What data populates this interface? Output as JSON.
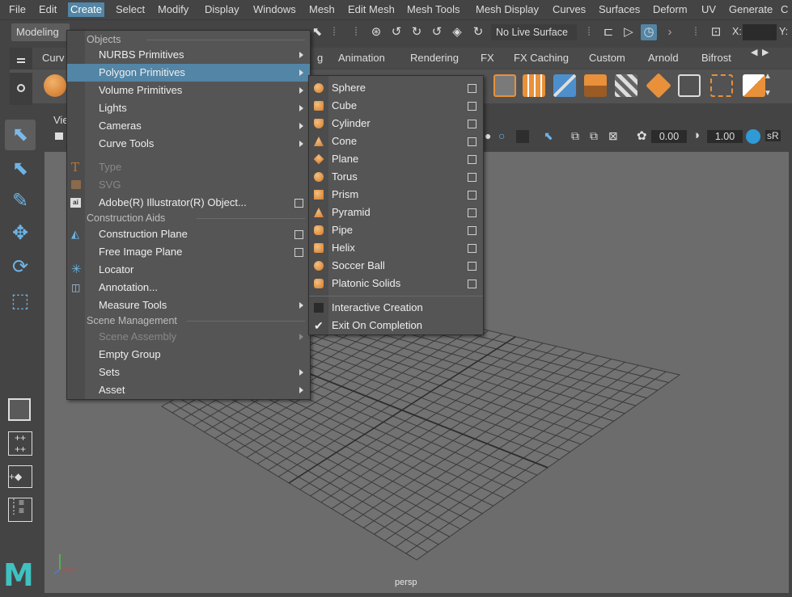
{
  "menubar": {
    "items": [
      "File",
      "Edit",
      "Create",
      "Select",
      "Modify",
      "Display",
      "Windows",
      "Mesh",
      "Edit Mesh",
      "Mesh Tools",
      "Mesh Display",
      "Curves",
      "Surfaces",
      "Deform",
      "UV",
      "Generate",
      "C"
    ]
  },
  "status_line": {
    "mode": "Modeling",
    "live_surface": "No Live Surface",
    "x_label": "X:",
    "y_label": "Y:"
  },
  "shelf": {
    "tabs": [
      "Curv",
      "g",
      "Animation",
      "Rendering",
      "FX",
      "FX Caching",
      "Custom",
      "Arnold",
      "Bifrost"
    ]
  },
  "viewport": {
    "panel_menu": "Vie",
    "value_a": "0.00",
    "value_b": "1.00",
    "value_c": "sR",
    "camera": "persp"
  },
  "create_menu": {
    "sections": {
      "objects": "Objects",
      "construction_aids": "Construction Aids",
      "scene_management": "Scene Management"
    },
    "items": {
      "nurbs": "NURBS Primitives",
      "polygon": "Polygon Primitives",
      "volume": "Volume Primitives",
      "lights": "Lights",
      "cameras": "Cameras",
      "curve_tools": "Curve Tools",
      "type": "Type",
      "svg": "SVG",
      "illustrator": "Adobe(R) Illustrator(R) Object...",
      "construction_plane": "Construction Plane",
      "free_image_plane": "Free Image Plane",
      "locator": "Locator",
      "annotation": "Annotation...",
      "measure_tools": "Measure Tools",
      "scene_assembly": "Scene Assembly",
      "empty_group": "Empty Group",
      "sets": "Sets",
      "asset": "Asset"
    }
  },
  "polygon_submenu": {
    "items": [
      "Sphere",
      "Cube",
      "Cylinder",
      "Cone",
      "Plane",
      "Torus",
      "Prism",
      "Pyramid",
      "Pipe",
      "Helix",
      "Soccer Ball",
      "Platonic Solids"
    ],
    "interactive_creation": "Interactive Creation",
    "exit_on_completion": "Exit On Completion"
  },
  "colors": {
    "highlight": "#5285a6",
    "accent_orange": "#e8903a",
    "accent_blue": "#6cb4e6"
  }
}
